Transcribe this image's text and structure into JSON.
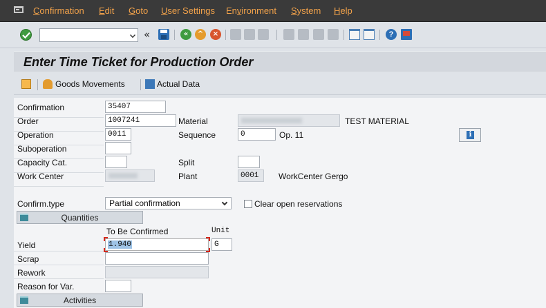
{
  "menu": {
    "items": [
      {
        "label": "Confirmation",
        "ul": "C",
        "rest": "onfirmation"
      },
      {
        "label": "Edit",
        "ul": "E",
        "rest": "dit"
      },
      {
        "label": "Goto",
        "ul": "G",
        "rest": "oto"
      },
      {
        "label": "User Settings",
        "ul": "U",
        "rest": "ser Settings"
      },
      {
        "label": "Environment",
        "pre": "En",
        "ul": "v",
        "rest": "ironment"
      },
      {
        "label": "System",
        "ul": "S",
        "rest": "ystem"
      },
      {
        "label": "Help",
        "ul": "H",
        "rest": "elp"
      }
    ]
  },
  "toolbar": {
    "command_value": "",
    "double_chevron": "«"
  },
  "title": "Enter Time Ticket for Production Order",
  "app_toolbar": {
    "goods_movements": "Goods Movements",
    "actual_data": "Actual Data"
  },
  "form": {
    "confirmation_label": "Confirmation",
    "confirmation_value": "35407",
    "order_label": "Order",
    "order_value": "1007241",
    "material_label": "Material",
    "material_value": "",
    "material_desc": "TEST MATERIAL",
    "operation_label": "Operation",
    "operation_value": "0011",
    "sequence_label": "Sequence",
    "sequence_value": "0",
    "op_desc": "Op. 11",
    "suboperation_label": "Suboperation",
    "suboperation_value": "",
    "capacity_label": "Capacity Cat.",
    "capacity_value": "",
    "split_label": "Split",
    "split_value": "",
    "workcenter_label": "Work Center",
    "workcenter_value": "",
    "plant_label": "Plant",
    "plant_value": "0001",
    "workcenter_desc": "WorkCenter Gergo",
    "confirm_type_label": "Confirm.type",
    "confirm_type_value": "Partial confirmation",
    "clear_reservations_label": "Clear open reservations",
    "quantities_label": "Quantities",
    "to_be_confirmed_label": "To Be Confirmed",
    "unit_label": "Unit",
    "yield_label": "Yield",
    "yield_value": "1.940",
    "yield_unit": "G",
    "scrap_label": "Scrap",
    "scrap_value": "",
    "rework_label": "Rework",
    "rework_value": "",
    "reason_label": "Reason for Var.",
    "reason_value": "",
    "activities_label": "Activities"
  }
}
